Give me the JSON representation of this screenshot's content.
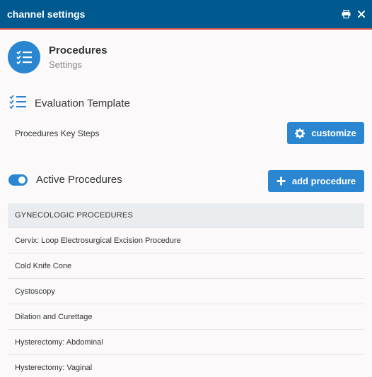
{
  "window": {
    "title": "channel settings",
    "icons": [
      "print-icon",
      "close-icon"
    ]
  },
  "header": {
    "title": "Procedures",
    "subtitle": "Settings",
    "icon": "checklist-icon"
  },
  "evaluation": {
    "title": "Evaluation Template",
    "icon": "checklist-icon",
    "row_label": "Procedures Key Steps",
    "customize_label": "customize"
  },
  "active": {
    "title": "Active Procedures",
    "toggle_on": true,
    "add_label": "add procedure"
  },
  "list": {
    "header": "GYNECOLOGIC PROCEDURES",
    "items": [
      "Cervix: Loop Electrosurgical Excision Procedure",
      "Cold Knife Cone",
      "Cystoscopy",
      "Dilation and Curettage",
      "Hysterectomy: Abdominal",
      "Hysterectomy: Vaginal"
    ]
  },
  "colors": {
    "titlebar": "#00598f",
    "accent": "#2a86d1",
    "title_underline": "#d9534f"
  }
}
